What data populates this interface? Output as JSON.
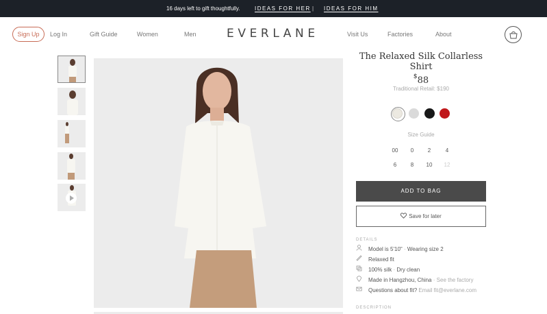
{
  "promo": {
    "message": "16 days left to gift thoughtfully.",
    "ideas_her": "IDEAS FOR HER",
    "separator": "|",
    "ideas_him": "IDEAS FOR HIM"
  },
  "nav": {
    "sign_up": "Sign Up",
    "log_in": "Log In",
    "gift_guide": "Gift Guide",
    "women": "Women",
    "men": "Men",
    "logo": "EVERLANE",
    "visit_us": "Visit Us",
    "factories": "Factories",
    "about": "About"
  },
  "product": {
    "title": "The Relaxed Silk Collarless Shirt",
    "currency": "$",
    "price": "88",
    "retail": "Traditional Retail: $190",
    "colors": [
      {
        "name": "off-white",
        "hex": "#ece9e1",
        "selected": true
      },
      {
        "name": "light-grey",
        "hex": "#dadada",
        "selected": false
      },
      {
        "name": "black",
        "hex": "#181818",
        "selected": false
      },
      {
        "name": "red",
        "hex": "#c0181b",
        "selected": false
      }
    ],
    "size_guide": "Size Guide",
    "sizes": [
      "00",
      "0",
      "2",
      "4",
      "6",
      "8",
      "10",
      "12"
    ],
    "add_to_bag": "ADD TO BAG",
    "save_for_later": "Save for later"
  },
  "details": {
    "heading": "DETAILS",
    "model": "Model is 5'10\"",
    "model_sep": "·",
    "model_size": "Wearing size 2",
    "fit": "Relaxed fit",
    "fabric": "100% silk",
    "fabric_sep": "·",
    "care": "Dry clean",
    "origin": "Made in Hangzhou, China",
    "origin_sep": "·",
    "factory_link": "See the factory",
    "questions": "Questions about fit?",
    "email": "Email fit@everlane.com"
  },
  "description": {
    "heading": "DESCRIPTION"
  }
}
